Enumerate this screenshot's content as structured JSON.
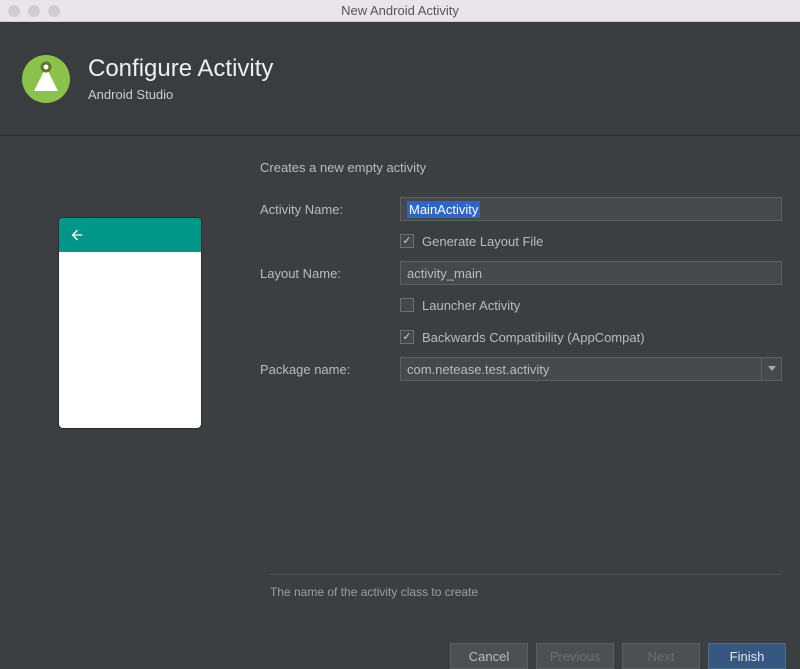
{
  "window": {
    "title": "New Android Activity"
  },
  "banner": {
    "title": "Configure Activity",
    "subtitle": "Android Studio"
  },
  "form": {
    "description": "Creates a new empty activity",
    "activity_name": {
      "label": "Activity Name:",
      "value": "MainActivity"
    },
    "generate_layout": {
      "label": "Generate Layout File",
      "checked": true
    },
    "layout_name": {
      "label": "Layout Name:",
      "value": "activity_main"
    },
    "launcher_activity": {
      "label": "Launcher Activity",
      "checked": false
    },
    "backwards_compat": {
      "label": "Backwards Compatibility (AppCompat)",
      "checked": true
    },
    "package_name": {
      "label": "Package name:",
      "value": "com.netease.test.activity"
    }
  },
  "help": {
    "text": "The name of the activity class to create"
  },
  "buttons": {
    "cancel": "Cancel",
    "previous": "Previous",
    "next": "Next",
    "finish": "Finish"
  },
  "colors": {
    "accent": "#009688",
    "logo_green": "#8bc34a"
  }
}
